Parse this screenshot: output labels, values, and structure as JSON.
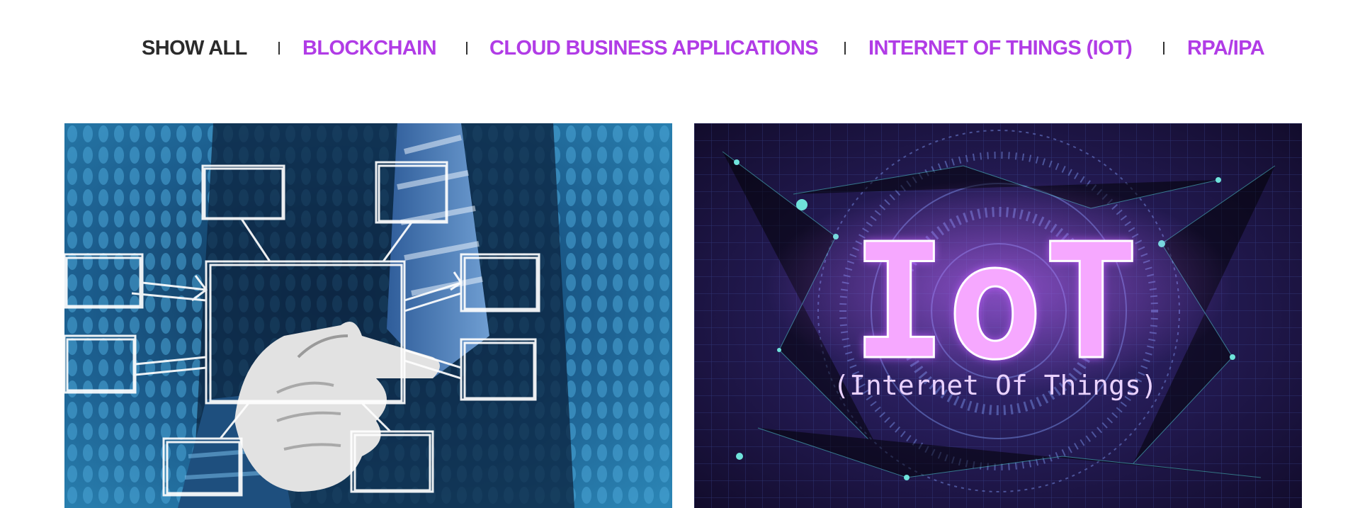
{
  "filters": {
    "items": [
      {
        "label": "SHOW ALL",
        "active": true
      },
      {
        "label": "BLOCKCHAIN",
        "active": false
      },
      {
        "label": "CLOUD BUSINESS APPLICATIONS",
        "active": false
      },
      {
        "label": "INTERNET OF THINGS (IOT)",
        "active": false
      },
      {
        "label": "RPA/IPA",
        "active": false
      }
    ]
  },
  "colors": {
    "accent": "#b13ce6",
    "active_text": "#2b2b2b",
    "separator": "#333333"
  },
  "tiles": [
    {
      "image": "business-flowchart-pointing-hand"
    },
    {
      "image": "iot-glowing-circuit",
      "headline": "IoT",
      "subline": "(Internet Of Things)"
    }
  ]
}
